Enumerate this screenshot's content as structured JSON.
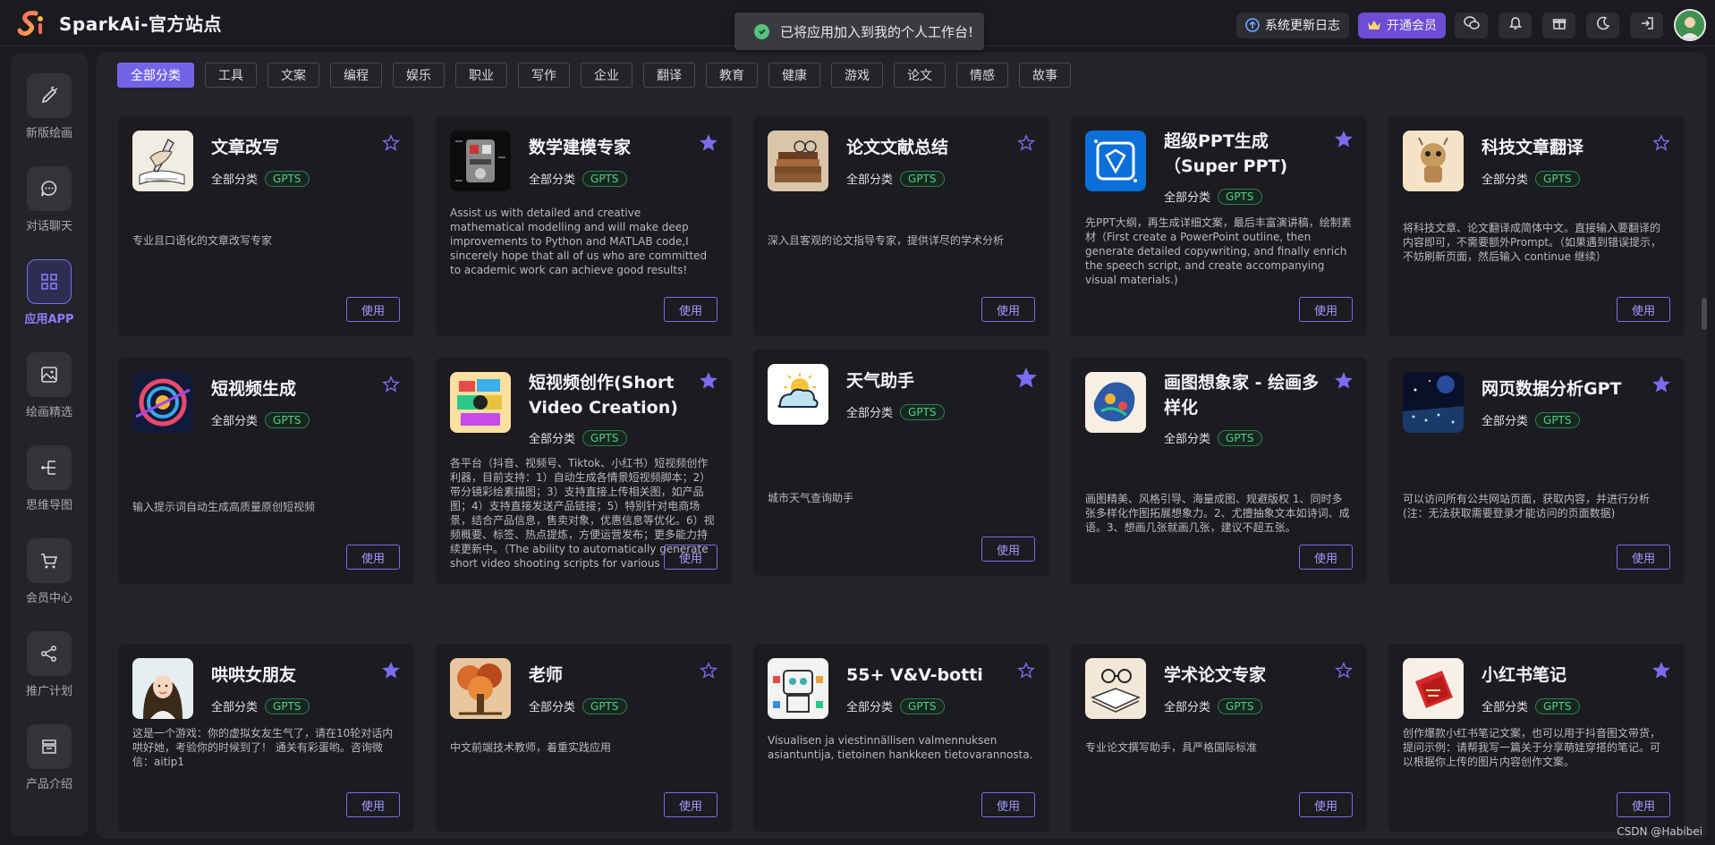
{
  "app": {
    "title": "SparkAi-官方站点"
  },
  "toast": {
    "message": "已将应用加入到我的个人工作台!"
  },
  "header": {
    "changelog_label": "系统更新日志",
    "vip_label": "开通会员"
  },
  "sidebar": {
    "items": [
      {
        "label": "新版绘画",
        "icon": "brush-icon"
      },
      {
        "label": "对话聊天",
        "icon": "chat-icon"
      },
      {
        "label": "应用APP",
        "icon": "apps-icon"
      },
      {
        "label": "绘画精选",
        "icon": "gallery-icon"
      },
      {
        "label": "思维导图",
        "icon": "mindmap-icon"
      },
      {
        "label": "会员中心",
        "icon": "cart-icon"
      },
      {
        "label": "推广计划",
        "icon": "share-icon"
      },
      {
        "label": "产品介绍",
        "icon": "product-icon"
      }
    ]
  },
  "tabs": [
    "全部分类",
    "工具",
    "文案",
    "编程",
    "娱乐",
    "职业",
    "写作",
    "企业",
    "翻译",
    "教育",
    "健康",
    "游戏",
    "论文",
    "情感",
    "故事"
  ],
  "use_label": "使用",
  "cards": [
    {
      "title": "文章改写",
      "category": "全部分类",
      "badge": "GPTS",
      "starred": false,
      "desc": "专业且口语化的文章改写专家"
    },
    {
      "title": "数学建模专家",
      "category": "全部分类",
      "badge": "GPTS",
      "starred": true,
      "desc": "Assist us with detailed and creative mathematical modelling and will make deep improvements to Python and MATLAB code,I sincerely hope that all of us who are committed to academic work can achieve good results!"
    },
    {
      "title": "论文文献总结",
      "category": "全部分类",
      "badge": "GPTS",
      "starred": false,
      "desc": "深入且客观的论文指导专家，提供详尽的学术分析"
    },
    {
      "title": "超级PPT生成（Super PPT)",
      "category": "全部分类",
      "badge": "GPTS",
      "starred": true,
      "desc": "先PPT大纲，再生成详细文案，最后丰富演讲稿，绘制素材（First create a PowerPoint outline, then generate detailed copywriting, and finally enrich the speech script, and create accompanying visual materials.)"
    },
    {
      "title": "科技文章翻译",
      "category": "全部分类",
      "badge": "GPTS",
      "starred": false,
      "desc": "将科技文章、论文翻译成简体中文。直接输入要翻译的内容即可，不需要额外Prompt。（如果遇到错误提示，不妨刷新页面，然后输入 continue 继续）"
    },
    {
      "title": "短视频生成",
      "category": "全部分类",
      "badge": "GPTS",
      "starred": false,
      "desc": "输入提示词自动生成高质量原创短视频"
    },
    {
      "title": "短视频创作(Short Video Creation)",
      "category": "全部分类",
      "badge": "GPTS",
      "starred": true,
      "desc": "各平台（抖音、视频号、Tiktok、小红书）短视频创作利器，目前支持：1）自动生成各情景短视频脚本；2）带分镜彩绘素描图；3）支持直接上传相关图，如产品图；4）支持直接发送产品链接；5）特别针对电商场景，结合产品信息，售卖对象，优惠信息等优化。6）视频概要、标签、热点提炼，方便运营发布；更多能力持续更新中。（The ability to automatically generate short video shooting scripts for various scenarios, es"
    },
    {
      "title": "天气助手",
      "category": "全部分类",
      "badge": "GPTS",
      "starred": true,
      "desc": "城市天气查询助手"
    },
    {
      "title": "画图想象家 - 绘画多样化",
      "category": "全部分类",
      "badge": "GPTS",
      "starred": true,
      "desc": "画图精美、风格引导、海量成图、规避版权 1、同时多张多样化作图拓展想象力。2、尤擅抽象文本如诗词、成语。3、想画几张就画几张，建议不超五张。"
    },
    {
      "title": "网页数据分析GPT",
      "category": "全部分类",
      "badge": "GPTS",
      "starred": true,
      "desc": "可以访问所有公共网站页面，获取内容，并进行分析(注：无法获取需要登录才能访问的页面数据)"
    },
    {
      "title": "哄哄女朋友",
      "category": "全部分类",
      "badge": "GPTS",
      "starred": true,
      "desc": "这是一个游戏：你的虚拟女友生气了，请在10轮对话内哄好她，考验你的时候到了！ 通关有彩蛋哟。咨询微信：aitip1"
    },
    {
      "title": "老师",
      "category": "全部分类",
      "badge": "GPTS",
      "starred": false,
      "desc": "中文前端技术教师，着重实践应用"
    },
    {
      "title": "55+ V&V-botti",
      "category": "全部分类",
      "badge": "GPTS",
      "starred": false,
      "desc": "Visualisen ja viestinnällisen valmennuksen asiantuntija, tietoinen hankkeen tietovarannosta."
    },
    {
      "title": "学术论文专家",
      "category": "全部分类",
      "badge": "GPTS",
      "starred": false,
      "desc": "专业论文撰写助手，具严格国际标准"
    },
    {
      "title": "小红书笔记",
      "category": "全部分类",
      "badge": "GPTS",
      "starred": true,
      "desc": "创作爆款小红书笔记文案，也可以用于抖音图文带货，提问示例：请帮我写一篇关于分享萌娃穿搭的笔记。可以根据你上传的图片内容创作文案。"
    }
  ],
  "footer": {
    "credit": "CSDN @Habibei"
  },
  "colors": {
    "accent": "#7463e8",
    "badge": "#4fcf86",
    "star": "#7a6cf0"
  }
}
